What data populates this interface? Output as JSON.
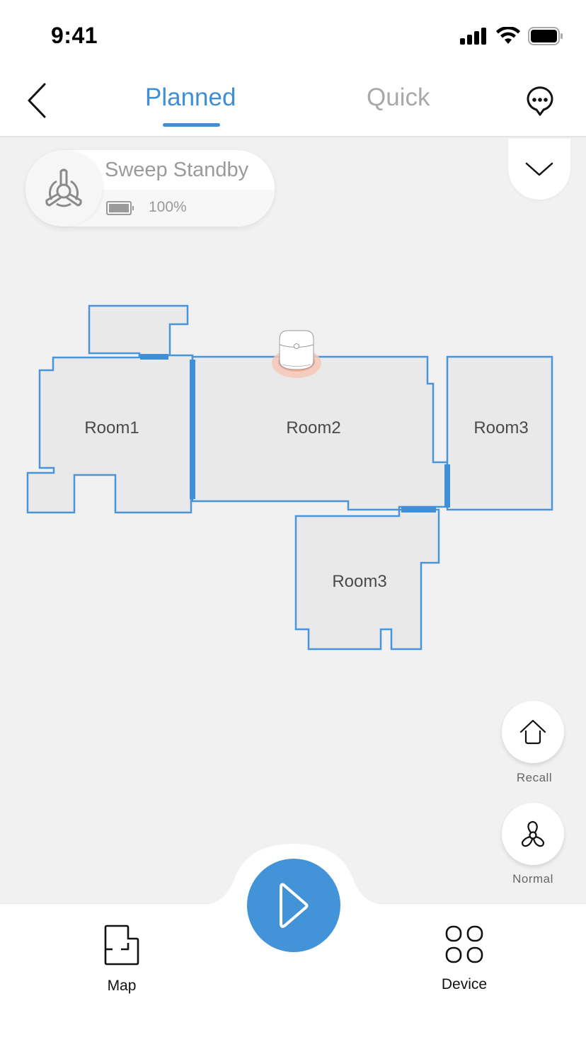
{
  "status_bar": {
    "time": "9:41",
    "icons": [
      "cellular-signal-icon",
      "wifi-icon",
      "battery-icon"
    ]
  },
  "nav": {
    "back_icon": "chevron-left-icon",
    "tabs": [
      {
        "label": "Planned",
        "active": true
      },
      {
        "label": "Quick",
        "active": false
      }
    ],
    "message_icon": "chat-bubble-icon"
  },
  "device_status": {
    "icon": "fan-propeller-icon",
    "title": "Sweep Standby",
    "battery_percent": "100%",
    "battery_level": 1.0
  },
  "dropdown": {
    "icon": "chevron-down-icon"
  },
  "map": {
    "rooms": [
      {
        "name": "Room1"
      },
      {
        "name": "Room2"
      },
      {
        "name": "Room3"
      },
      {
        "name": "Room3"
      }
    ],
    "robot": {
      "icon": "robot-vacuum-icon",
      "room": "Room2"
    }
  },
  "side_controls": [
    {
      "label": "Recall",
      "icon": "home-icon"
    },
    {
      "label": "Normal",
      "icon": "fan-icon"
    }
  ],
  "bottom_nav": {
    "play_icon": "play-icon",
    "items": [
      {
        "label": "Map",
        "icon": "floor-plan-icon"
      },
      {
        "label": "Device",
        "icon": "grid-icon"
      }
    ]
  },
  "colors": {
    "accent": "#3f8fd6",
    "wall": "#3f8fd6",
    "room_fill": "#e9e9e9",
    "background": "#f1f1f1",
    "inactive_tab": "#a9a9a9",
    "robot_glow": "#f29a7f"
  }
}
